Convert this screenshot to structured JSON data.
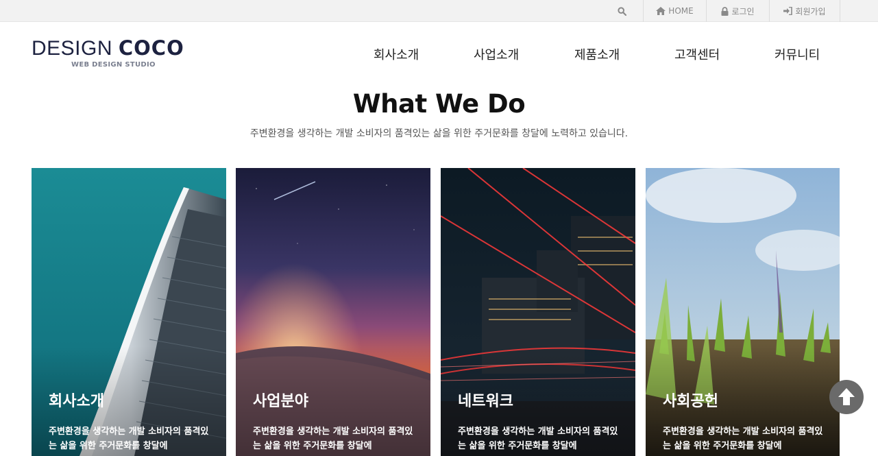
{
  "utility": {
    "search_icon": "search-icon",
    "home_label": "HOME",
    "login_label": "로그인",
    "join_label": "회원가입"
  },
  "logo": {
    "main_thin": "DESIGN ",
    "main_bold": "COCO",
    "sub": "WEB DESIGN STUDIO"
  },
  "nav": {
    "items": [
      {
        "label": "회사소개"
      },
      {
        "label": "사업소개"
      },
      {
        "label": "제품소개"
      },
      {
        "label": "고객센터"
      },
      {
        "label": "커뮤니티"
      }
    ]
  },
  "section": {
    "title": "What We Do",
    "subtitle": "주변환경을 생각하는 개발 소비자의 품격있는 삶을 위한 주거문화를 창달에 노력하고 있습니다."
  },
  "cards": [
    {
      "title": "회사소개",
      "desc": "주변환경을 생각하는 개발 소비자의 품격있는 삶을 위한 주거문화를 창달에",
      "image": "skyscraper"
    },
    {
      "title": "사업분야",
      "desc": "주변환경을 생각하는 개발 소비자의 품격있는 삶을 위한 주거문화를 창달에",
      "image": "desert-sunset"
    },
    {
      "title": "네트워크",
      "desc": "주변환경을 생각하는 개발 소비자의 품격있는 삶을 위한 주거문화를 창달에",
      "image": "city-light-trails"
    },
    {
      "title": "사회공헌",
      "desc": "주변환경을 생각하는 개발 소비자의 품격있는 삶을 위한 주거문화를 창달에",
      "image": "grass-sprouts"
    }
  ],
  "colors": {
    "topbar_bg": "#f2f2f2",
    "logo": "#1d2240",
    "scroll_button": "#6a6a6a"
  }
}
